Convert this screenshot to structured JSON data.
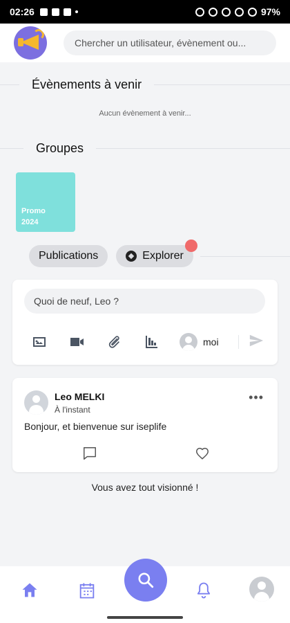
{
  "status_bar": {
    "time": "02:26",
    "battery": "97%"
  },
  "header": {
    "search_placeholder": "Chercher un utilisateur, évènement ou..."
  },
  "events": {
    "title": "Évènements à venir",
    "empty_text": "Aucun évènement à venir..."
  },
  "groups": {
    "title": "Groupes",
    "items": [
      {
        "label": "Promo\n2024",
        "color": "#7fe0dc"
      }
    ]
  },
  "tabs": [
    {
      "label": "Publications"
    },
    {
      "label": "Explorer",
      "icon": "compass-icon",
      "has_badge": true
    }
  ],
  "composer": {
    "placeholder": "Quoi de neuf, Leo ?",
    "tools": [
      "image-icon",
      "video-icon",
      "attachment-icon",
      "poll-icon"
    ],
    "audience_label": "moi",
    "send_icon": "send-icon"
  },
  "post": {
    "author": "Leo MELKI",
    "time": "À l'instant",
    "body": "Bonjour, et bienvenue sur iseplife",
    "more_icon": "more-icon"
  },
  "feed_end_text": "Vous avez tout visionné !",
  "bottom_nav": {
    "items": [
      "home-icon",
      "calendar-icon",
      "search-icon",
      "bell-icon",
      "profile-icon"
    ],
    "accent": "#7a7ff0"
  }
}
